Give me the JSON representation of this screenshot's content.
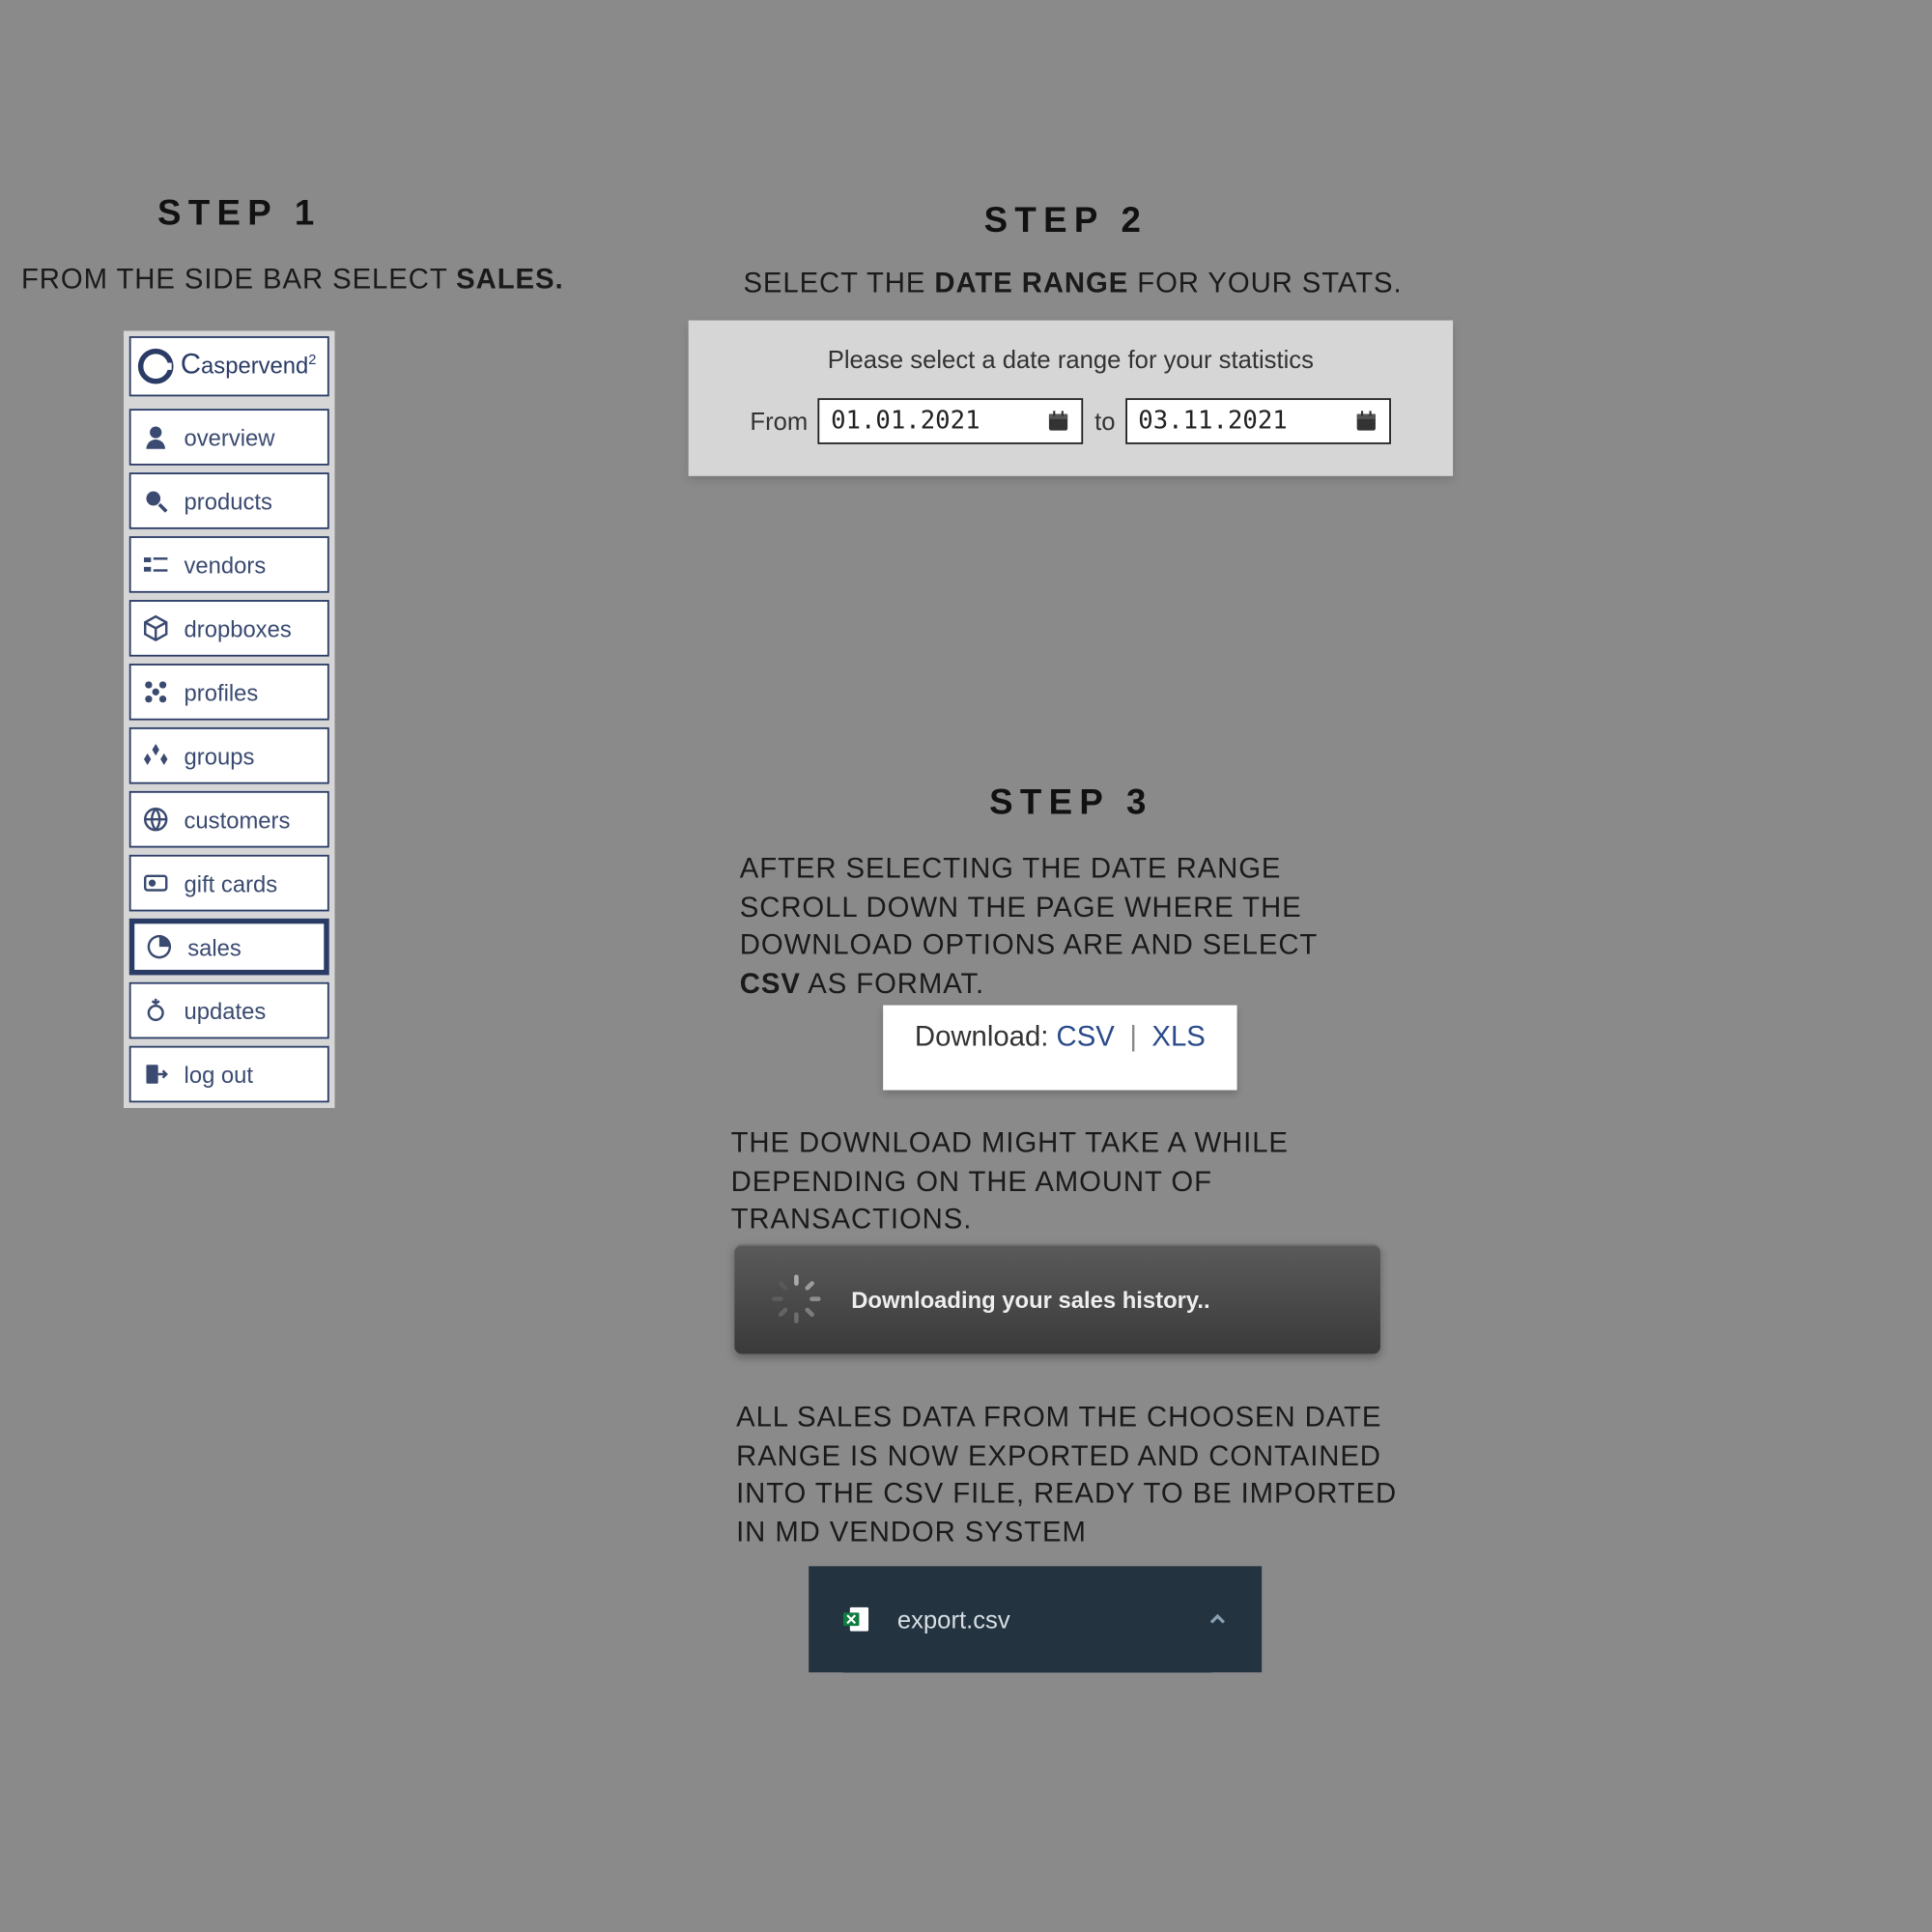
{
  "step1": {
    "heading": "STEP 1",
    "instr_pre": "FROM THE SIDE BAR SELECT ",
    "instr_bold": "SALES."
  },
  "step2": {
    "heading": "STEP 2",
    "instr_pre": "SELECT THE ",
    "instr_bold": "DATE RANGE",
    "instr_post": " FOR YOUR STATS."
  },
  "step3": {
    "heading": "STEP 3",
    "instr_a_pre": "AFTER SELECTING THE DATE RANGE SCROLL DOWN THE PAGE WHERE THE DOWNLOAD OPTIONS ARE AND SELECT ",
    "instr_a_bold": "CSV",
    "instr_a_post": " AS FORMAT.",
    "instr_b": "THE DOWNLOAD MIGHT TAKE A WHILE DEPENDING ON THE AMOUNT OF TRANSACTIONS.",
    "instr_c": "ALL SALES DATA FROM THE CHOOSEN DATE RANGE IS NOW EXPORTED AND CONTAINED INTO THE CSV FILE, READY TO BE IMPORTED IN MD VENDOR SYSTEM"
  },
  "sidebar": {
    "logo_text": "aspervend",
    "logo_sup": "2",
    "items": [
      {
        "label": "overview"
      },
      {
        "label": "products"
      },
      {
        "label": "vendors"
      },
      {
        "label": "dropboxes"
      },
      {
        "label": "profiles"
      },
      {
        "label": "groups"
      },
      {
        "label": "customers"
      },
      {
        "label": "gift cards"
      },
      {
        "label": "sales"
      },
      {
        "label": "updates"
      },
      {
        "label": "log out"
      }
    ]
  },
  "date_panel": {
    "title": "Please select a date range for your statistics",
    "from_label": "From",
    "from_value": "01.01.2021",
    "to_label": "to",
    "to_value": "03.11.2021"
  },
  "download": {
    "label": "Download: ",
    "csv": "CSV",
    "xls": "XLS"
  },
  "progress": {
    "text": "Downloading your sales history.."
  },
  "export_chip": {
    "filename": "export.csv"
  }
}
